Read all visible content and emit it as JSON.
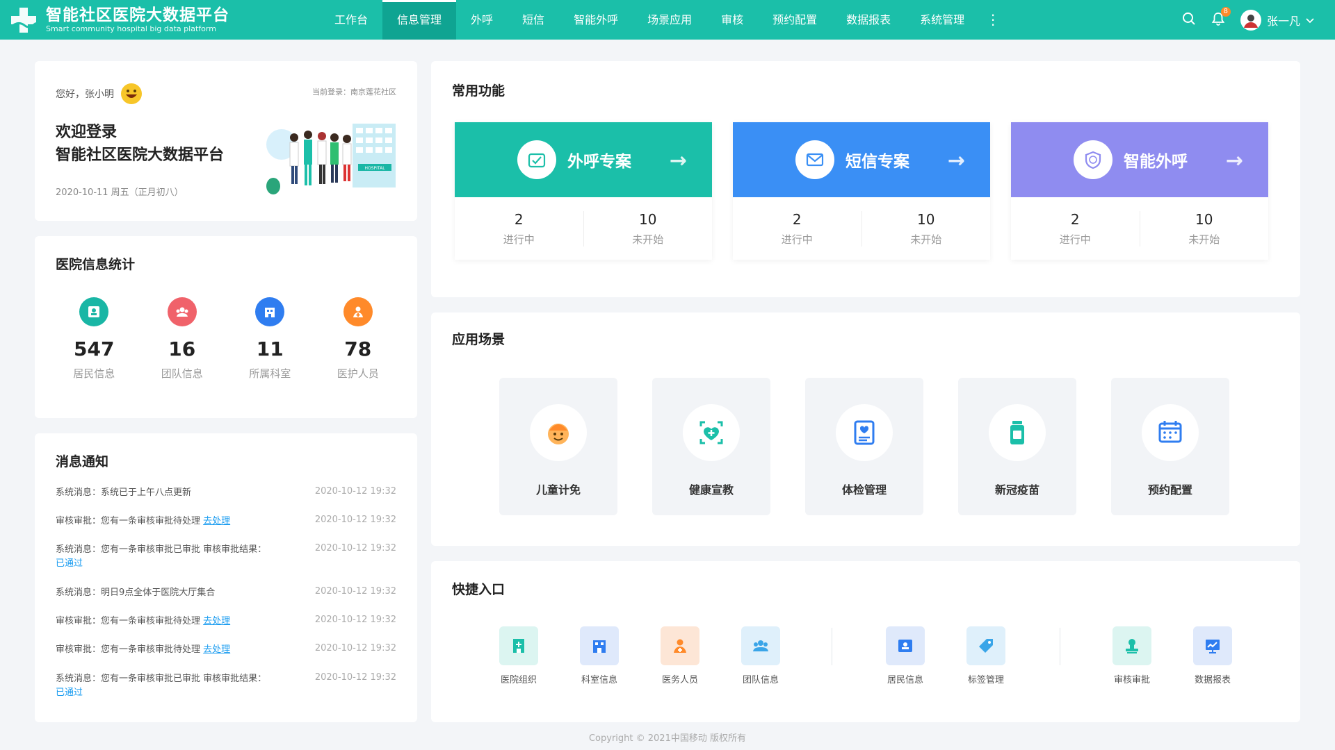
{
  "app": {
    "title": "智能社区医院大数据平台",
    "subtitle": "Smart community hospital big data platform"
  },
  "nav": {
    "items": [
      "工作台",
      "信息管理",
      "外呼",
      "短信",
      "智能外呼",
      "场景应用",
      "审核",
      "预约配置",
      "数据报表",
      "系统管理"
    ],
    "active": "信息管理",
    "more": "⋮"
  },
  "header": {
    "notification_count": "8",
    "user_name": "张一凡"
  },
  "welcome": {
    "greeting": "您好，张小明",
    "current_login": "当前登录：南京莲花社区",
    "title_line1": "欢迎登录",
    "title_line2": "智能社区医院大数据平台",
    "date": "2020-10-11  周五（正月初八）",
    "illustration_sign": "HOSPITAL"
  },
  "stats": {
    "title": "医院信息统计",
    "items": [
      {
        "value": "547",
        "label": "居民信息",
        "color": "#19b6a5",
        "icon": "id-card-icon"
      },
      {
        "value": "16",
        "label": "团队信息",
        "color": "#f0626a",
        "icon": "team-icon"
      },
      {
        "value": "11",
        "label": "所属科室",
        "color": "#2f7df0",
        "icon": "department-icon"
      },
      {
        "value": "78",
        "label": "医护人员",
        "color": "#ff8a2a",
        "icon": "medical-staff-icon"
      }
    ]
  },
  "messages": {
    "title": "消息通知",
    "items": [
      {
        "text": "系统消息：系统已于上午八点更新",
        "link": "",
        "time": "2020-10-12  19:32"
      },
      {
        "text": "审核审批：您有一条审核审批待处理 ",
        "link": "去处理",
        "time": "2020-10-12  19:32"
      },
      {
        "text": "系统消息：您有一条审核审批已审批 审核审批结果：",
        "link": "已通过",
        "time": "2020-10-12  19:32"
      },
      {
        "text": "系统消息：明日9点全体于医院大厅集合",
        "link": "",
        "time": "2020-10-12  19:32"
      },
      {
        "text": "审核审批：您有一条审核审批待处理 ",
        "link": "去处理",
        "time": "2020-10-12  19:32"
      },
      {
        "text": "审核审批：您有一条审核审批待处理 ",
        "link": "去处理",
        "time": "2020-10-12  19:32"
      },
      {
        "text": "系统消息：您有一条审核审批已审批 审核审批结果：",
        "link": "已通过",
        "time": "2020-10-12  19:32"
      }
    ]
  },
  "common": {
    "title": "常用功能",
    "items": [
      {
        "label": "外呼专案",
        "color": "#1bbfa9",
        "icon": "phone-check-icon",
        "progress": "2",
        "progress_label": "进行中",
        "pending": "10",
        "pending_label": "未开始"
      },
      {
        "label": "短信专案",
        "color": "#3a8ff5",
        "icon": "mail-icon",
        "progress": "2",
        "progress_label": "进行中",
        "pending": "10",
        "pending_label": "未开始"
      },
      {
        "label": "智能外呼",
        "color": "#8f8cf0",
        "icon": "ai-call-icon",
        "progress": "2",
        "progress_label": "进行中",
        "pending": "10",
        "pending_label": "未开始"
      }
    ]
  },
  "scenes": {
    "title": "应用场景",
    "items": [
      {
        "label": "儿童计免",
        "icon": "child-face-icon",
        "color": "#ff8a2a"
      },
      {
        "label": "健康宣教",
        "icon": "heart-scan-icon",
        "color": "#1bbfa9"
      },
      {
        "label": "体检管理",
        "icon": "checkup-report-icon",
        "color": "#2f7df0"
      },
      {
        "label": "新冠疫苗",
        "icon": "vaccine-bottle-icon",
        "color": "#1bbfa9"
      },
      {
        "label": "预约配置",
        "icon": "calendar-icon",
        "color": "#2f7df0"
      }
    ]
  },
  "shortcuts": {
    "title": "快捷入口",
    "items": [
      {
        "label": "医院组织",
        "icon": "hospital-icon",
        "bg": "#dcf5f1",
        "fg": "#1bbfa9"
      },
      {
        "label": "科室信息",
        "icon": "department-icon",
        "bg": "#dfe9fb",
        "fg": "#2f7df0"
      },
      {
        "label": "医务人员",
        "icon": "medical-staff-icon",
        "bg": "#fde6d6",
        "fg": "#ff8a2a"
      },
      {
        "label": "团队信息",
        "icon": "team-icon",
        "bg": "#dff0fb",
        "fg": "#3aa5e8"
      },
      {
        "label": "居民信息",
        "icon": "id-card-icon",
        "bg": "#dfe9fb",
        "fg": "#2f7df0"
      },
      {
        "label": "标签管理",
        "icon": "tag-icon",
        "bg": "#dff0fb",
        "fg": "#3aa5e8"
      },
      {
        "label": "审核审批",
        "icon": "approve-icon",
        "bg": "#dcf5f1",
        "fg": "#1bbfa9"
      },
      {
        "label": "数据报表",
        "icon": "report-chart-icon",
        "bg": "#dfe9fb",
        "fg": "#2f7df0"
      }
    ]
  },
  "footer": "Copyright © 2021中国移动  版权所有"
}
